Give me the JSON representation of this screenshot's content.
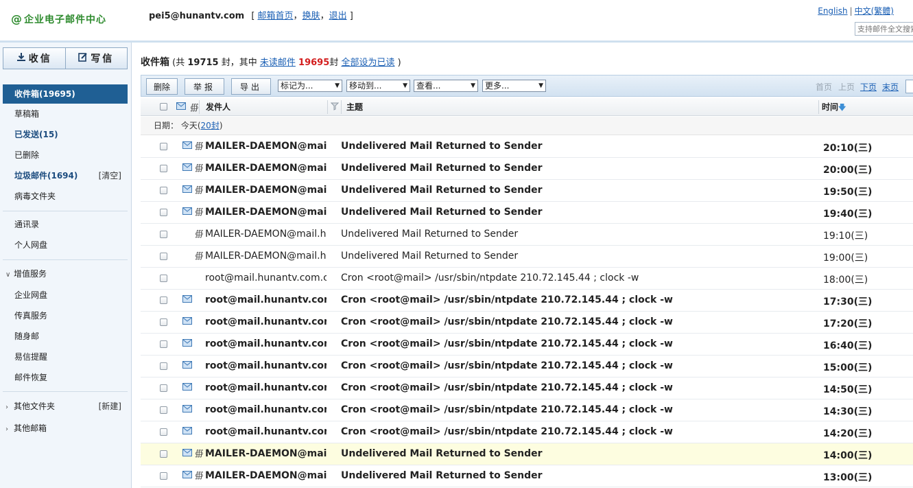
{
  "header": {
    "logo_text": "企业电子邮件中心",
    "user_email": "pei5@hunantv.com",
    "links": {
      "bracket_open": "[",
      "home": "邮箱首页",
      "comma1": "，",
      "skin": "换肤",
      "comma2": "，",
      "logout": "退出",
      "bracket_close": "]"
    },
    "lang_english": "English",
    "lang_sep": "|",
    "lang_trad": "中文(繁體)",
    "search_placeholder": "支持邮件全文搜索"
  },
  "sidebar": {
    "receive_label": "收信",
    "compose_label": "写信",
    "items": [
      {
        "label": "收件箱(19695)"
      },
      {
        "label": "草稿箱"
      },
      {
        "label": "已发送(15)"
      },
      {
        "label": "已删除"
      },
      {
        "label": "垃圾邮件(1694)",
        "action": "[清空]"
      },
      {
        "label": "病毒文件夹"
      },
      {
        "label": "通讯录"
      },
      {
        "label": "个人网盘"
      },
      {
        "label": "增值服务"
      },
      {
        "label": "企业网盘"
      },
      {
        "label": "传真服务"
      },
      {
        "label": "随身邮"
      },
      {
        "label": "易信提醒"
      },
      {
        "label": "邮件恢复"
      },
      {
        "label": "其他文件夹",
        "action": "[新建]"
      },
      {
        "label": "其他邮箱"
      }
    ]
  },
  "main": {
    "title": "收件箱",
    "summary_pre": "(共",
    "total": "19715",
    "summary_mid": "封，其中",
    "unread_link": "未读邮件",
    "unread_count": "19695",
    "summary_unit": "封",
    "mark_all_read": "全部设为已读",
    "summary_close": ")"
  },
  "toolbar": {
    "delete": "删除",
    "report": "举报",
    "export": "导出",
    "mark_as": "标记为...",
    "move_to": "移动到...",
    "view": "查看...",
    "more": "更多...",
    "first_page": "首页",
    "prev_page": "上页",
    "next_page": "下页",
    "last_page": "末页"
  },
  "list": {
    "col_from": "发件人",
    "col_subject": "主题",
    "col_time": "时间",
    "date_label": "日期：",
    "date_value": "今天",
    "date_count_pre": "(",
    "date_count": "20封",
    "date_count_post": ")",
    "rows": [
      {
        "from": "MAILER-DAEMON@mail.hunantv.com",
        "subject": "Undelivered Mail Returned to Sender",
        "time": "20:10(三)",
        "unread": true,
        "envelope": true,
        "clip": true
      },
      {
        "from": "MAILER-DAEMON@mail.hunantv.com",
        "subject": "Undelivered Mail Returned to Sender",
        "time": "20:00(三)",
        "unread": true,
        "envelope": true,
        "clip": true
      },
      {
        "from": "MAILER-DAEMON@mail.hunantv.com",
        "subject": "Undelivered Mail Returned to Sender",
        "time": "19:50(三)",
        "unread": true,
        "envelope": true,
        "clip": true
      },
      {
        "from": "MAILER-DAEMON@mail.hunantv.com",
        "subject": "Undelivered Mail Returned to Sender",
        "time": "19:40(三)",
        "unread": true,
        "envelope": true,
        "clip": true
      },
      {
        "from": "MAILER-DAEMON@mail.hunantv.com",
        "subject": "Undelivered Mail Returned to Sender",
        "time": "19:10(三)",
        "unread": false,
        "envelope": false,
        "clip": true
      },
      {
        "from": "MAILER-DAEMON@mail.hunantv.com",
        "subject": "Undelivered Mail Returned to Sender",
        "time": "19:00(三)",
        "unread": false,
        "envelope": false,
        "clip": true
      },
      {
        "from": "root@mail.hunantv.com.cn",
        "subject": "Cron <root@mail> /usr/sbin/ntpdate 210.72.145.44 ; clock -w",
        "time": "18:00(三)",
        "unread": false,
        "envelope": false,
        "clip": false
      },
      {
        "from": "root@mail.hunantv.com",
        "subject": "Cron <root@mail> /usr/sbin/ntpdate 210.72.145.44 ; clock -w",
        "time": "17:30(三)",
        "unread": true,
        "envelope": true,
        "clip": false
      },
      {
        "from": "root@mail.hunantv.com",
        "subject": "Cron <root@mail> /usr/sbin/ntpdate 210.72.145.44 ; clock -w",
        "time": "17:20(三)",
        "unread": true,
        "envelope": true,
        "clip": false
      },
      {
        "from": "root@mail.hunantv.com",
        "subject": "Cron <root@mail> /usr/sbin/ntpdate 210.72.145.44 ; clock -w",
        "time": "16:40(三)",
        "unread": true,
        "envelope": true,
        "clip": false
      },
      {
        "from": "root@mail.hunantv.com",
        "subject": "Cron <root@mail> /usr/sbin/ntpdate 210.72.145.44 ; clock -w",
        "time": "15:00(三)",
        "unread": true,
        "envelope": true,
        "clip": false
      },
      {
        "from": "root@mail.hunantv.com",
        "subject": "Cron <root@mail> /usr/sbin/ntpdate 210.72.145.44 ; clock -w",
        "time": "14:50(三)",
        "unread": true,
        "envelope": true,
        "clip": false
      },
      {
        "from": "root@mail.hunantv.com",
        "subject": "Cron <root@mail> /usr/sbin/ntpdate 210.72.145.44 ; clock -w",
        "time": "14:30(三)",
        "unread": true,
        "envelope": true,
        "clip": false
      },
      {
        "from": "root@mail.hunantv.com",
        "subject": "Cron <root@mail> /usr/sbin/ntpdate 210.72.145.44 ; clock -w",
        "time": "14:20(三)",
        "unread": true,
        "envelope": true,
        "clip": false
      },
      {
        "from": "MAILER-DAEMON@mail.hunantv.com",
        "subject": "Undelivered Mail Returned to Sender",
        "time": "14:00(三)",
        "unread": true,
        "envelope": true,
        "clip": true,
        "highlight": true
      },
      {
        "from": "MAILER-DAEMON@mail.hunantv.com",
        "subject": "Undelivered Mail Returned to Sender",
        "time": "13:00(三)",
        "unread": true,
        "envelope": true,
        "clip": true
      }
    ]
  },
  "colors": {
    "accent": "#1f5f94",
    "link": "#1a5fb4",
    "unread_count": "#d31d1d",
    "logo": "#2e8b2e",
    "highlight_row": "#fdfde0"
  },
  "icons": {
    "logo": "at-sign-icon",
    "receive": "download-arrow-icon",
    "compose": "edit-pencil-icon",
    "envelope": "envelope-icon",
    "attachment": "paperclip-icon",
    "sort": "sort-desc-arrow-icon",
    "flag": "flag-icon",
    "group_arrow": "chevron-icon"
  }
}
